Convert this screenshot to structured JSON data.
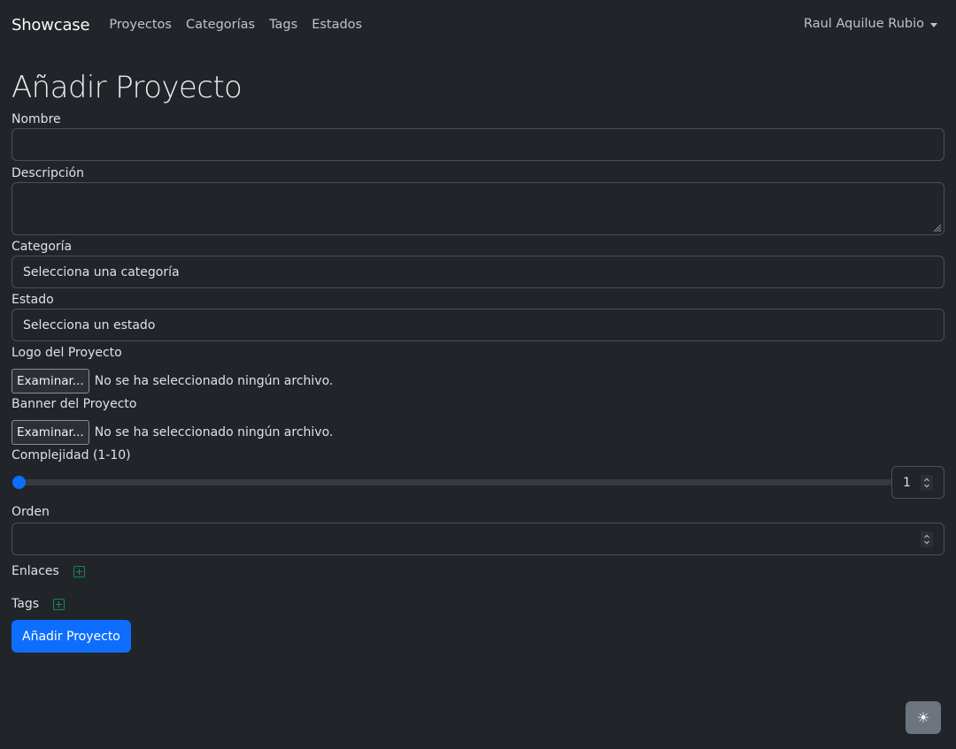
{
  "nav": {
    "brand": "Showcase",
    "links": [
      "Proyectos",
      "Categorías",
      "Tags",
      "Estados"
    ],
    "user": "Raul Aquilue Rubio"
  },
  "page": {
    "title": "Añadir Proyecto"
  },
  "form": {
    "nombre_label": "Nombre",
    "nombre_value": "",
    "descripcion_label": "Descripción",
    "descripcion_value": "",
    "categoria_label": "Categoría",
    "categoria_selected": "Selecciona una categoría",
    "estado_label": "Estado",
    "estado_selected": "Selecciona un estado",
    "logo_label": "Logo del Proyecto",
    "banner_label": "Banner del Proyecto",
    "file_button": "Examinar...",
    "file_none": "No se ha seleccionado ningún archivo.",
    "complejidad_label": "Complejidad (1-10)",
    "complejidad_value": "1",
    "complejidad_level": 1,
    "orden_label": "Orden",
    "orden_value": "",
    "enlaces_label": "Enlaces",
    "tags_label": "Tags",
    "submit_label": "Añadir Proyecto"
  },
  "theme_toggle": {
    "icon": "sun-icon",
    "glyph": "☀"
  },
  "colors": {
    "background": "#212529",
    "primary": "#0d6efd",
    "success": "#198754",
    "secondary": "#6c757d"
  }
}
